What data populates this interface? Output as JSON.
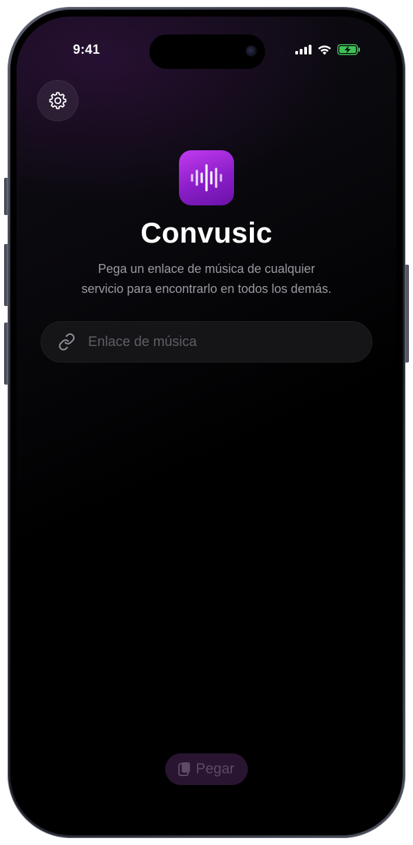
{
  "status_bar": {
    "time": "9:41"
  },
  "app": {
    "title": "Convusic",
    "subtitle_line1": "Pega un enlace de música de cualquier",
    "subtitle_line2": "servicio para encontrarlo en todos los demás.",
    "icon": "waveform-icon",
    "accent_color": "#a02bdc"
  },
  "link_input": {
    "placeholder": "Enlace de música",
    "value": "",
    "icon": "link-icon"
  },
  "settings_button": {
    "icon": "gear-icon"
  },
  "paste_button": {
    "label": "Pegar",
    "icon": "clipboard-icon"
  }
}
